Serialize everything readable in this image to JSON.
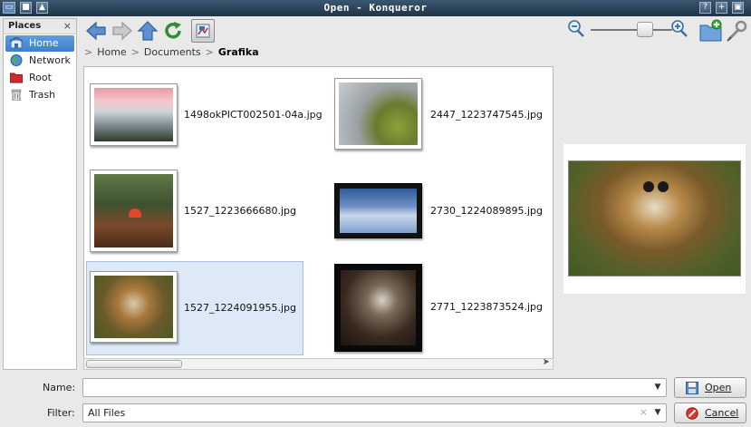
{
  "window": {
    "title": "Open - Konqueror"
  },
  "places": {
    "header": "Places",
    "items": [
      {
        "label": "Home"
      },
      {
        "label": "Network"
      },
      {
        "label": "Root"
      },
      {
        "label": "Trash"
      }
    ]
  },
  "breadcrumb": {
    "items": [
      "Home",
      "Documents",
      "Grafika"
    ]
  },
  "files": [
    {
      "name": "1498okPICT002501-04a.jpg"
    },
    {
      "name": "2447_1223747545.jpg"
    },
    {
      "name": "1527_1223666680.jpg"
    },
    {
      "name": "2730_1224089895.jpg"
    },
    {
      "name": "1527_1224091955.jpg"
    },
    {
      "name": "2771_1223873524.jpg"
    }
  ],
  "form": {
    "name_label": "Name:",
    "name_value": "",
    "filter_label": "Filter:",
    "filter_value": "All Files",
    "open_label": "Open",
    "cancel_label": "Cancel"
  }
}
